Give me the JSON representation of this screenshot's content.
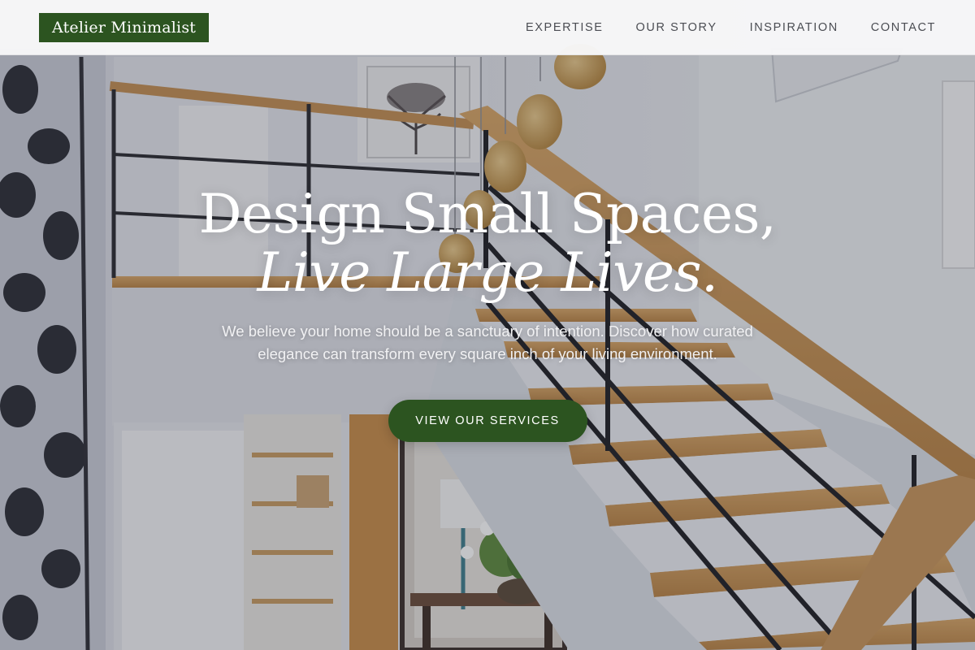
{
  "brand": {
    "name": "Atelier Minimalist",
    "color": "#2c5420"
  },
  "nav": {
    "links": [
      {
        "label": "EXPERTISE"
      },
      {
        "label": "OUR STORY"
      },
      {
        "label": "INSPIRATION"
      },
      {
        "label": "CONTACT"
      }
    ]
  },
  "hero": {
    "headline_line1": "Design Small Spaces,",
    "headline_line2": "Live Large Lives.",
    "subtext": "We believe your home should be a sanctuary of intention. Discover how curated elegance can transform every square inch of your living environment.",
    "cta_label": "VIEW OUR SERVICES",
    "background_image": "staircase-interior-photo"
  }
}
